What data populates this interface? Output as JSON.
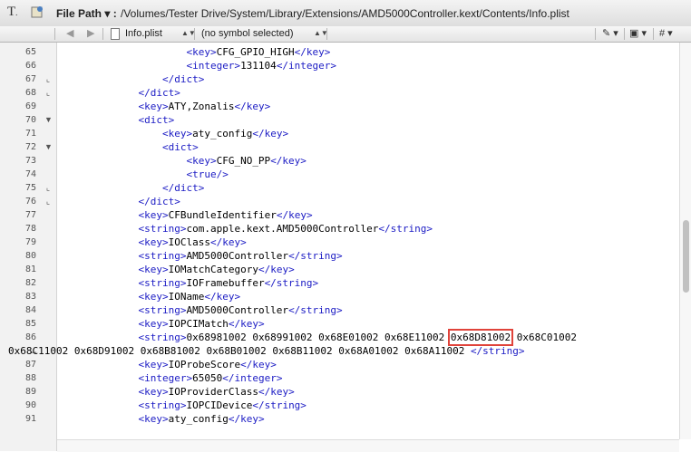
{
  "toolbar": {
    "label": "File Path ▾ :",
    "path": "/Volumes/Tester Drive/System/Library/Extensions/AMD5000Controller.kext/Contents/Info.plist"
  },
  "navbar": {
    "file": "Info.plist",
    "symbol": "(no symbol selected)",
    "hash": "#"
  },
  "highlight": "0x68D81002",
  "lines": [
    {
      "n": "65",
      "fold": "",
      "indent": "                    ",
      "parts": [
        {
          "t": "<key>",
          "tag": true
        },
        {
          "t": "CFG_GPIO_HIGH"
        },
        {
          "t": "</key>",
          "tag": true
        }
      ]
    },
    {
      "n": "66",
      "fold": "",
      "indent": "                    ",
      "parts": [
        {
          "t": "<integer>",
          "tag": true
        },
        {
          "t": "131104"
        },
        {
          "t": "</integer>",
          "tag": true
        }
      ]
    },
    {
      "n": "67",
      "fold": "end",
      "indent": "                ",
      "parts": [
        {
          "t": "</dict>",
          "tag": true
        }
      ]
    },
    {
      "n": "68",
      "fold": "end",
      "indent": "            ",
      "parts": [
        {
          "t": "</dict>",
          "tag": true
        }
      ]
    },
    {
      "n": "69",
      "fold": "",
      "indent": "            ",
      "parts": [
        {
          "t": "<key>",
          "tag": true
        },
        {
          "t": "ATY,Zonalis"
        },
        {
          "t": "</key>",
          "tag": true
        }
      ]
    },
    {
      "n": "70",
      "fold": "open",
      "indent": "            ",
      "parts": [
        {
          "t": "<dict>",
          "tag": true
        }
      ]
    },
    {
      "n": "71",
      "fold": "",
      "indent": "                ",
      "parts": [
        {
          "t": "<key>",
          "tag": true
        },
        {
          "t": "aty_config"
        },
        {
          "t": "</key>",
          "tag": true
        }
      ]
    },
    {
      "n": "72",
      "fold": "open",
      "indent": "                ",
      "parts": [
        {
          "t": "<dict>",
          "tag": true
        }
      ]
    },
    {
      "n": "73",
      "fold": "",
      "indent": "                    ",
      "parts": [
        {
          "t": "<key>",
          "tag": true
        },
        {
          "t": "CFG_NO_PP"
        },
        {
          "t": "</key>",
          "tag": true
        }
      ]
    },
    {
      "n": "74",
      "fold": "",
      "indent": "                    ",
      "parts": [
        {
          "t": "<true/>",
          "tag": true
        }
      ]
    },
    {
      "n": "75",
      "fold": "end",
      "indent": "                ",
      "parts": [
        {
          "t": "</dict>",
          "tag": true
        }
      ]
    },
    {
      "n": "76",
      "fold": "end",
      "indent": "            ",
      "parts": [
        {
          "t": "</dict>",
          "tag": true
        }
      ]
    },
    {
      "n": "77",
      "fold": "",
      "indent": "            ",
      "parts": [
        {
          "t": "<key>",
          "tag": true
        },
        {
          "t": "CFBundleIdentifier"
        },
        {
          "t": "</key>",
          "tag": true
        }
      ]
    },
    {
      "n": "78",
      "fold": "",
      "indent": "            ",
      "parts": [
        {
          "t": "<string>",
          "tag": true
        },
        {
          "t": "com.apple.kext.AMD5000Controller"
        },
        {
          "t": "</string>",
          "tag": true
        }
      ]
    },
    {
      "n": "79",
      "fold": "",
      "indent": "            ",
      "parts": [
        {
          "t": "<key>",
          "tag": true
        },
        {
          "t": "IOClass"
        },
        {
          "t": "</key>",
          "tag": true
        }
      ]
    },
    {
      "n": "80",
      "fold": "",
      "indent": "            ",
      "parts": [
        {
          "t": "<string>",
          "tag": true
        },
        {
          "t": "AMD5000Controller"
        },
        {
          "t": "</string>",
          "tag": true
        }
      ]
    },
    {
      "n": "81",
      "fold": "",
      "indent": "            ",
      "parts": [
        {
          "t": "<key>",
          "tag": true
        },
        {
          "t": "IOMatchCategory"
        },
        {
          "t": "</key>",
          "tag": true
        }
      ]
    },
    {
      "n": "82",
      "fold": "",
      "indent": "            ",
      "parts": [
        {
          "t": "<string>",
          "tag": true
        },
        {
          "t": "IOFramebuffer"
        },
        {
          "t": "</string>",
          "tag": true
        }
      ]
    },
    {
      "n": "83",
      "fold": "",
      "indent": "            ",
      "parts": [
        {
          "t": "<key>",
          "tag": true
        },
        {
          "t": "IOName"
        },
        {
          "t": "</key>",
          "tag": true
        }
      ]
    },
    {
      "n": "84",
      "fold": "",
      "indent": "            ",
      "parts": [
        {
          "t": "<string>",
          "tag": true
        },
        {
          "t": "AMD5000Controller"
        },
        {
          "t": "</string>",
          "tag": true
        }
      ]
    },
    {
      "n": "85",
      "fold": "",
      "indent": "            ",
      "parts": [
        {
          "t": "<key>",
          "tag": true
        },
        {
          "t": "IOPCIMatch"
        },
        {
          "t": "</key>",
          "tag": true
        }
      ]
    },
    {
      "n": "86",
      "fold": "",
      "indent": "            ",
      "parts": [
        {
          "t": "<string>",
          "tag": true
        },
        {
          "t": "0x68981002 0x68991002 0x68E01002 0x68E11002 "
        },
        {
          "t": "0x68D81002",
          "hl": true
        },
        {
          "t": " 0x68C01002"
        }
      ]
    },
    {
      "n": "…",
      "fold": "",
      "indent": "",
      "parts": [
        {
          "t": "0x68C11002 0x68D91002 0x68B81002 0x68B01002 0x68B11002 0x68A01002 0x68A11002 "
        },
        {
          "t": "</string>",
          "tag": true
        }
      ]
    },
    {
      "n": "87",
      "fold": "",
      "indent": "            ",
      "parts": [
        {
          "t": "<key>",
          "tag": true
        },
        {
          "t": "IOProbeScore"
        },
        {
          "t": "</key>",
          "tag": true
        }
      ]
    },
    {
      "n": "88",
      "fold": "",
      "indent": "            ",
      "parts": [
        {
          "t": "<integer>",
          "tag": true
        },
        {
          "t": "65050"
        },
        {
          "t": "</integer>",
          "tag": true
        }
      ]
    },
    {
      "n": "89",
      "fold": "",
      "indent": "            ",
      "parts": [
        {
          "t": "<key>",
          "tag": true
        },
        {
          "t": "IOProviderClass"
        },
        {
          "t": "</key>",
          "tag": true
        }
      ]
    },
    {
      "n": "90",
      "fold": "",
      "indent": "            ",
      "parts": [
        {
          "t": "<string>",
          "tag": true
        },
        {
          "t": "IOPCIDevice"
        },
        {
          "t": "</string>",
          "tag": true
        }
      ]
    },
    {
      "n": "91",
      "fold": "",
      "indent": "            ",
      "parts": [
        {
          "t": "<key>",
          "tag": true
        },
        {
          "t": "aty_config"
        },
        {
          "t": "</key>",
          "tag": true
        }
      ]
    }
  ]
}
